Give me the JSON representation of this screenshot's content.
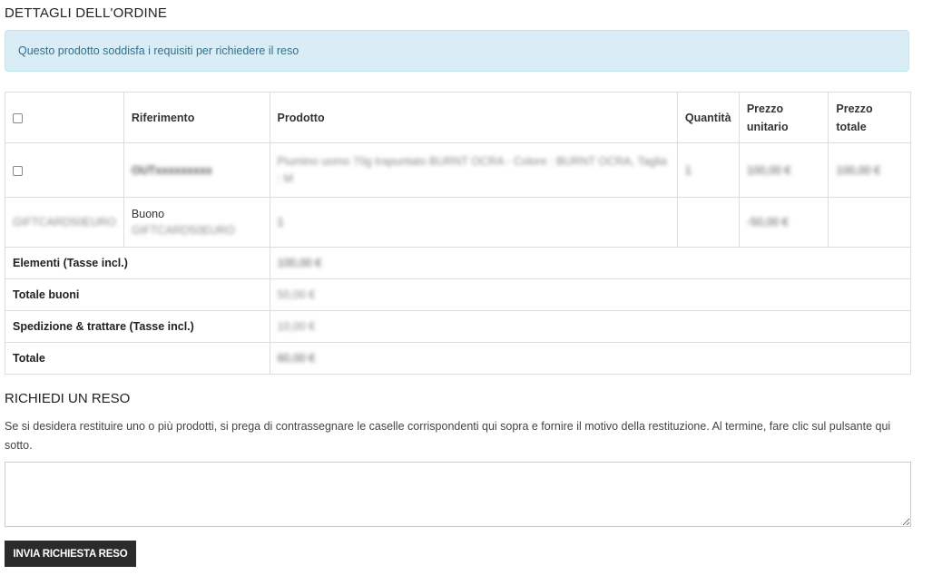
{
  "order_details": {
    "title": "DETTAGLI DELL'ORDINE",
    "alert": "Questo prodotto  soddisfa i requisiti per richiedere il reso"
  },
  "table": {
    "headers": {
      "reference": "Riferimento",
      "product": "Prodotto",
      "quantity": "Quantità",
      "unit_price": "Prezzo unitario",
      "total_price": "Prezzo totale"
    },
    "rows": [
      {
        "reference": "OUTxxxxxxxxx",
        "product": "Piumino uomo 70g trapuntato BURNT OCRA - Colore : BURNT OCRA, Taglia : M",
        "quantity": "1",
        "unit_price": "100,00 €",
        "total_price": "100,00 €"
      },
      {
        "code": "GIFTCARD50EURO",
        "reference_label": "Buono",
        "reference_code": "GIFTCARD50EURO",
        "quantity": "1",
        "unit_price": "-50,00 €",
        "total_price": ""
      }
    ],
    "totals": [
      {
        "label": "Elementi (Tasse incl.)",
        "value": "100,00 €"
      },
      {
        "label": "Totale buoni",
        "value": "50,00 €"
      },
      {
        "label": "Spedizione & trattare (Tasse incl.)",
        "value": "10,00 €"
      },
      {
        "label": "Totale",
        "value": "60,00 €"
      }
    ]
  },
  "return_request": {
    "title": "RICHIEDI UN RESO",
    "description": "Se si desidera restituire uno o più prodotti, si prega di contrassegnare le caselle corrispondenti qui sopra e fornire il motivo della restituzione. Al termine, fare clic sul pulsante qui sotto.",
    "textarea_value": "",
    "submit_label": "INVIA RICHIESTA RESO"
  }
}
